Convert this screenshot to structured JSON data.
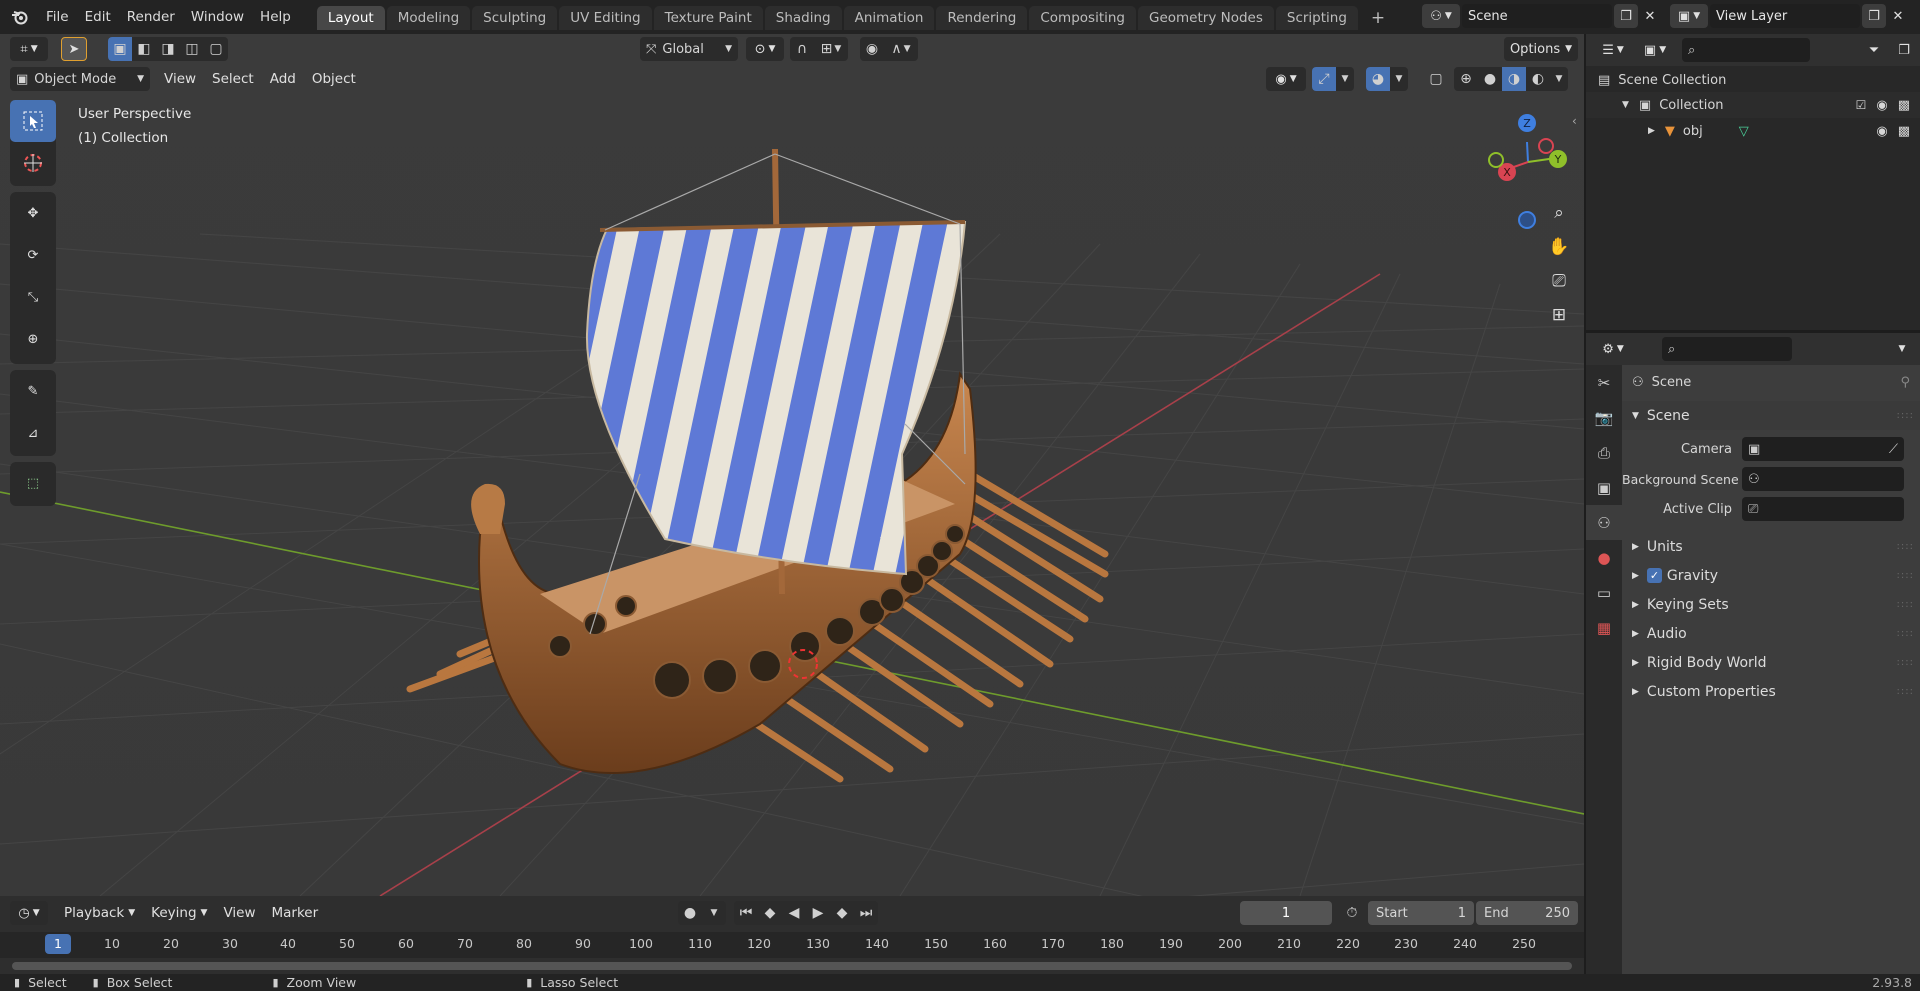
{
  "topbar": {
    "menus": [
      "File",
      "Edit",
      "Render",
      "Window",
      "Help"
    ],
    "workspaces": [
      "Layout",
      "Modeling",
      "Sculpting",
      "UV Editing",
      "Texture Paint",
      "Shading",
      "Animation",
      "Rendering",
      "Compositing",
      "Geometry Nodes",
      "Scripting"
    ],
    "active_workspace": "Layout",
    "add_tab": "+",
    "scene_name": "Scene",
    "view_layer": "View Layer"
  },
  "viewport": {
    "transform_orientation": "Global",
    "options_label": "Options",
    "mode": "Object Mode",
    "menus": [
      "View",
      "Select",
      "Add",
      "Object"
    ],
    "overlay_title": "User Perspective",
    "overlay_subtitle": "(1) Collection",
    "gizmo": {
      "x": "X",
      "y": "Y",
      "z": "Z"
    }
  },
  "outliner": {
    "root": "Scene Collection",
    "collection": "Collection",
    "object": "obj"
  },
  "properties": {
    "header": "Scene",
    "panel": "Scene",
    "fields": [
      {
        "label": "Camera",
        "value": ""
      },
      {
        "label": "Background Scene",
        "value": ""
      },
      {
        "label": "Active Clip",
        "value": ""
      }
    ],
    "subpanels": [
      "Units",
      "Gravity",
      "Keying Sets",
      "Audio",
      "Rigid Body World",
      "Custom Properties"
    ],
    "gravity_checked": true
  },
  "timeline": {
    "menus": [
      "Playback",
      "Keying",
      "View",
      "Marker"
    ],
    "current_frame": "1",
    "start_label": "Start",
    "start": "1",
    "end_label": "End",
    "end": "250",
    "ticks": [
      "1",
      "10",
      "20",
      "30",
      "40",
      "50",
      "60",
      "70",
      "80",
      "90",
      "100",
      "110",
      "120",
      "130",
      "140",
      "150",
      "160",
      "170",
      "180",
      "190",
      "200",
      "210",
      "220",
      "230",
      "240",
      "250"
    ]
  },
  "status": {
    "items": [
      "Select",
      "Box Select",
      "Zoom View",
      "Lasso Select"
    ],
    "version": "2.93.8"
  },
  "colors": {
    "accent": "#4772b3",
    "x_axis": "#d94452",
    "y_axis": "#8fbf2a",
    "z_axis": "#3f7fe0",
    "viewport_bg": "#3a3a3a"
  }
}
